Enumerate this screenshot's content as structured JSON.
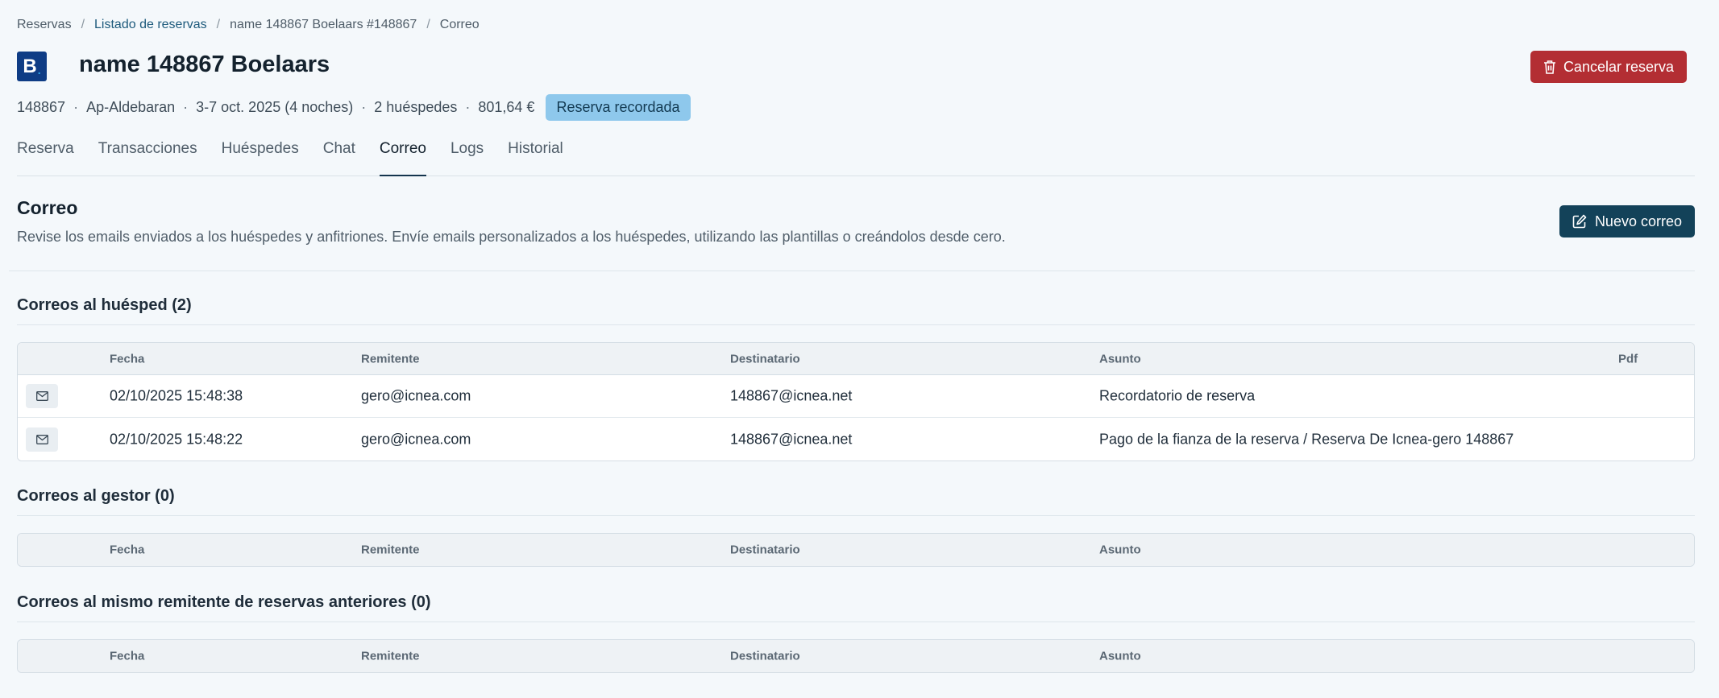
{
  "breadcrumb": {
    "items": [
      "Reservas",
      "Listado de reservas",
      "name 148867 Boelaars #148867",
      "Correo"
    ],
    "separator": "/"
  },
  "header": {
    "logo_letter": "B",
    "logo_dot": ".",
    "title": "name 148867 Boelaars",
    "cancel_label": "Cancelar reserva",
    "summary": {
      "id": "148867",
      "apartment": "Ap-Aldebaran",
      "dates": "3-7 oct. 2025 (4 noches)",
      "guests": "2 huéspedes",
      "amount": "801,64 €",
      "badge": "Reserva recordada",
      "dot": "·"
    }
  },
  "tabs": [
    {
      "label": "Reserva"
    },
    {
      "label": "Transacciones"
    },
    {
      "label": "Huéspedes"
    },
    {
      "label": "Chat"
    },
    {
      "label": "Correo",
      "active": true
    },
    {
      "label": "Logs"
    },
    {
      "label": "Historial"
    }
  ],
  "correo": {
    "title": "Correo",
    "description": "Revise los emails enviados a los huéspedes y anfitriones. Envíe emails personalizados a los huéspedes, utilizando las plantillas o creándolos desde cero.",
    "new_label": "Nuevo correo"
  },
  "columns": {
    "fecha": "Fecha",
    "remitente": "Remitente",
    "destinatario": "Destinatario",
    "asunto": "Asunto",
    "pdf": "Pdf"
  },
  "guest_emails": {
    "title": "Correos al huésped (2)",
    "rows": [
      {
        "fecha": "02/10/2025 15:48:38",
        "remitente": "gero@icnea.com",
        "destinatario": "148867@icnea.net",
        "asunto": "Recordatorio de reserva"
      },
      {
        "fecha": "02/10/2025 15:48:22",
        "remitente": "gero@icnea.com",
        "destinatario": "148867@icnea.net",
        "asunto": "Pago de la fianza de la reserva / Reserva De Icnea-gero 148867"
      }
    ]
  },
  "manager_emails": {
    "title": "Correos al gestor (0)"
  },
  "previous_emails": {
    "title": "Correos al mismo remitente de reservas anteriores (0)"
  },
  "colors": {
    "background": "#f4f8fb",
    "cancel_button": "#b32e33",
    "new_button": "#134259",
    "badge": "#8ec8ec",
    "brand_logo": "#0e3c85"
  },
  "icons": {
    "cancel": "trash-icon",
    "new": "edit-icon",
    "row": "envelope-icon"
  }
}
